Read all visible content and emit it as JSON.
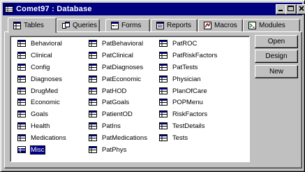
{
  "window": {
    "title": "Comet97 : Database",
    "controls": {
      "minimize": "minimize",
      "maximize": "maximize",
      "close": "close"
    }
  },
  "tabs": [
    {
      "label": "Tables",
      "icon": "table-icon",
      "active": true
    },
    {
      "label": "Queries",
      "icon": "query-icon",
      "active": false
    },
    {
      "label": "Forms",
      "icon": "form-icon",
      "active": false
    },
    {
      "label": "Reports",
      "icon": "report-icon",
      "active": false
    },
    {
      "label": "Macros",
      "icon": "macro-icon",
      "active": false
    },
    {
      "label": "Modules",
      "icon": "module-icon",
      "active": false
    }
  ],
  "tables": {
    "column1": [
      "Behavioral",
      "Clinical",
      "Config",
      "Diagnoses",
      "DrugMed",
      "Economic",
      "Goals",
      "Health",
      "Medications",
      "Misc"
    ],
    "column2": [
      "PatBehavioral",
      "PatClinical",
      "PatDiagnoses",
      "PatEconomic",
      "PatHOD",
      "PatGoals",
      "PatientOD",
      "PatIns",
      "PatMedications",
      "PatPhys"
    ],
    "column3": [
      "PatROC",
      "PatRiskFactors",
      "PatTests",
      "Physician",
      "PlanOfCare",
      "POPMenu",
      "RiskFactors",
      "TestDetails",
      "Tests"
    ],
    "selected": "Misc"
  },
  "buttons": {
    "open": "Open",
    "design": "Design",
    "new": "New"
  },
  "colors": {
    "titlebar": "#000080",
    "face": "#c0c0c0",
    "selection": "#000080"
  }
}
